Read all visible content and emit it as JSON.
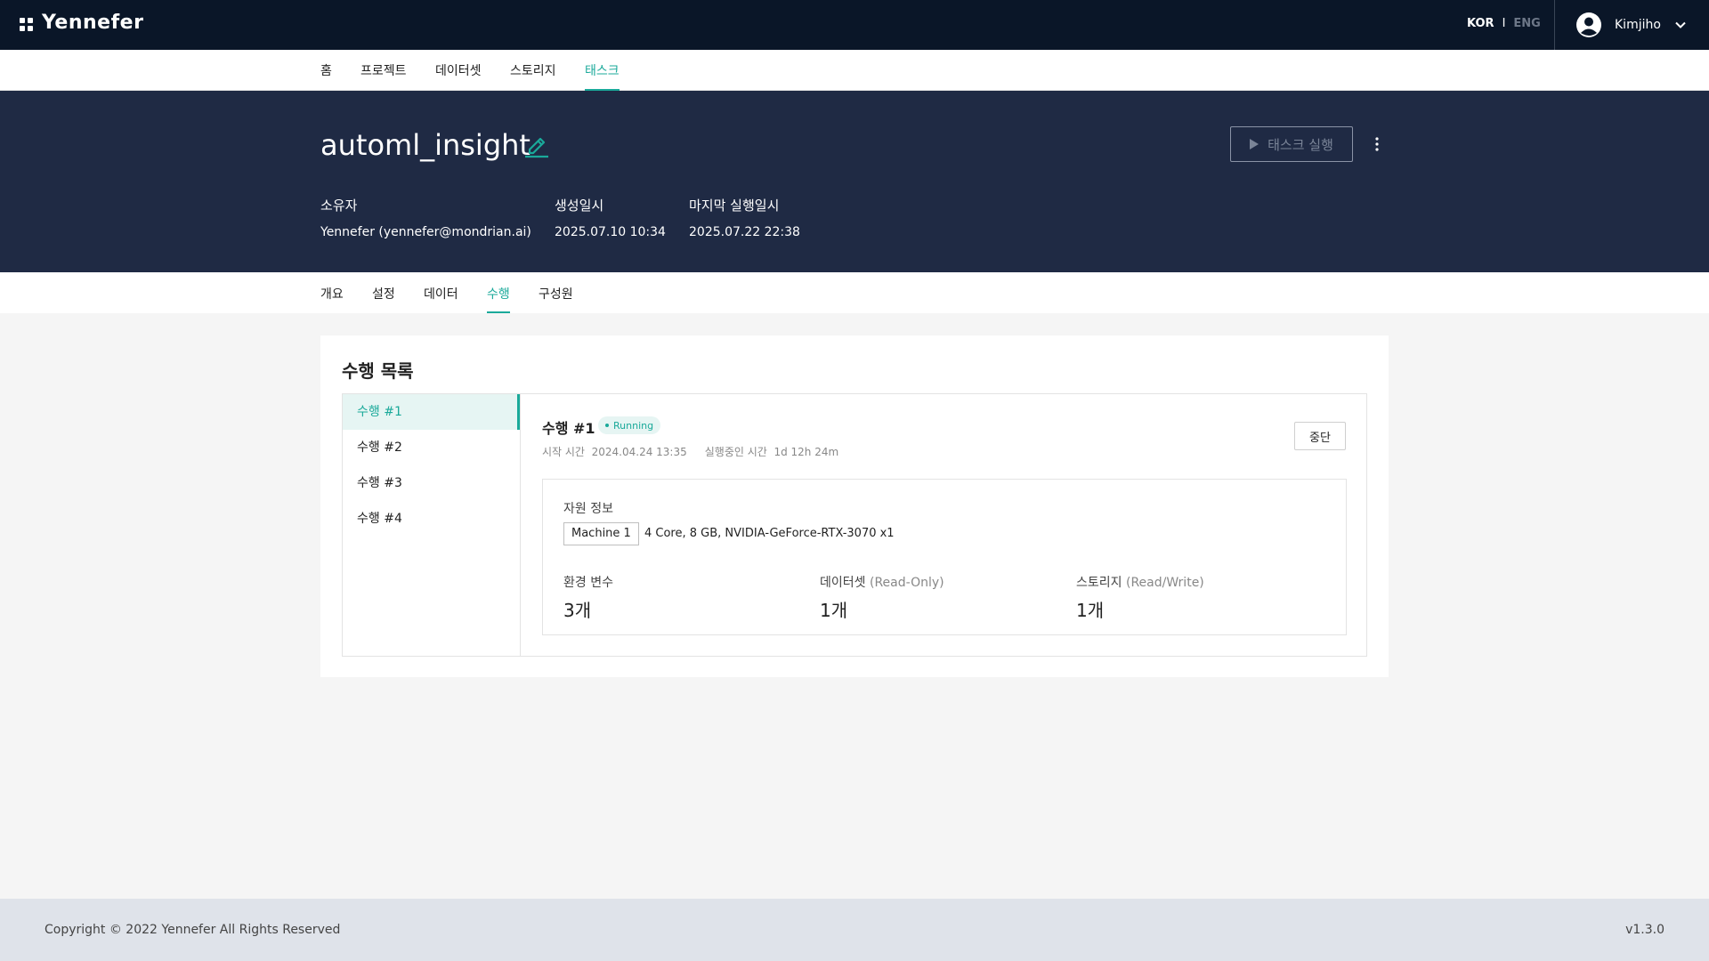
{
  "topbar": {
    "logo": "Yennefer",
    "lang": {
      "kor": "KOR",
      "sep": "I",
      "eng": "ENG"
    },
    "username": "Kimjiho"
  },
  "mainnav": {
    "items": [
      "홈",
      "프로젝트",
      "데이터셋",
      "스토리지",
      "태스크"
    ],
    "active": "태스크"
  },
  "header": {
    "title": "automl_insight",
    "run_button": "태스크 실행",
    "owner_label": "소유자",
    "owner_value": "Yennefer (yennefer@mondrian.ai)",
    "created_label": "생성일시",
    "created_value": "2025.07.10 10:34",
    "last_run_label": "마지막 실행일시",
    "last_run_value": "2025.07.22 22:38"
  },
  "subtabs": {
    "items": [
      "개요",
      "설정",
      "데이터",
      "수행",
      "구성원"
    ],
    "active": "수행"
  },
  "runs": {
    "title": "수행 목록",
    "list": [
      "수행 #1",
      "수행 #2",
      "수행 #3",
      "수행 #4"
    ],
    "selected": {
      "title": "수행 #1",
      "status": "Running",
      "start_label": "시작 시간",
      "start_value": "2024.04.24 13:35",
      "elapsed_label": "실행중인 시간",
      "elapsed_value": "1d 12h 24m",
      "stop_button": "중단",
      "resource_label": "자원 정보",
      "machine": "Machine 1",
      "spec": "4 Core, 8 GB, NVIDIA-GeForce-RTX-3070 x1",
      "env_label": "환경 변수",
      "env_value": "3개",
      "dataset_label": "데이터셋",
      "dataset_mode": "(Read-Only)",
      "dataset_value": "1개",
      "storage_label": "스토리지",
      "storage_mode": "(Read/Write)",
      "storage_value": "1개"
    }
  },
  "footer": {
    "copyright": "Copyright © 2022 Yennefer All Rights Reserved",
    "version": "v1.3.0"
  },
  "colors": {
    "topbar": "#0a1628",
    "hero": "#1f2a44",
    "accent": "#1aa99a"
  }
}
